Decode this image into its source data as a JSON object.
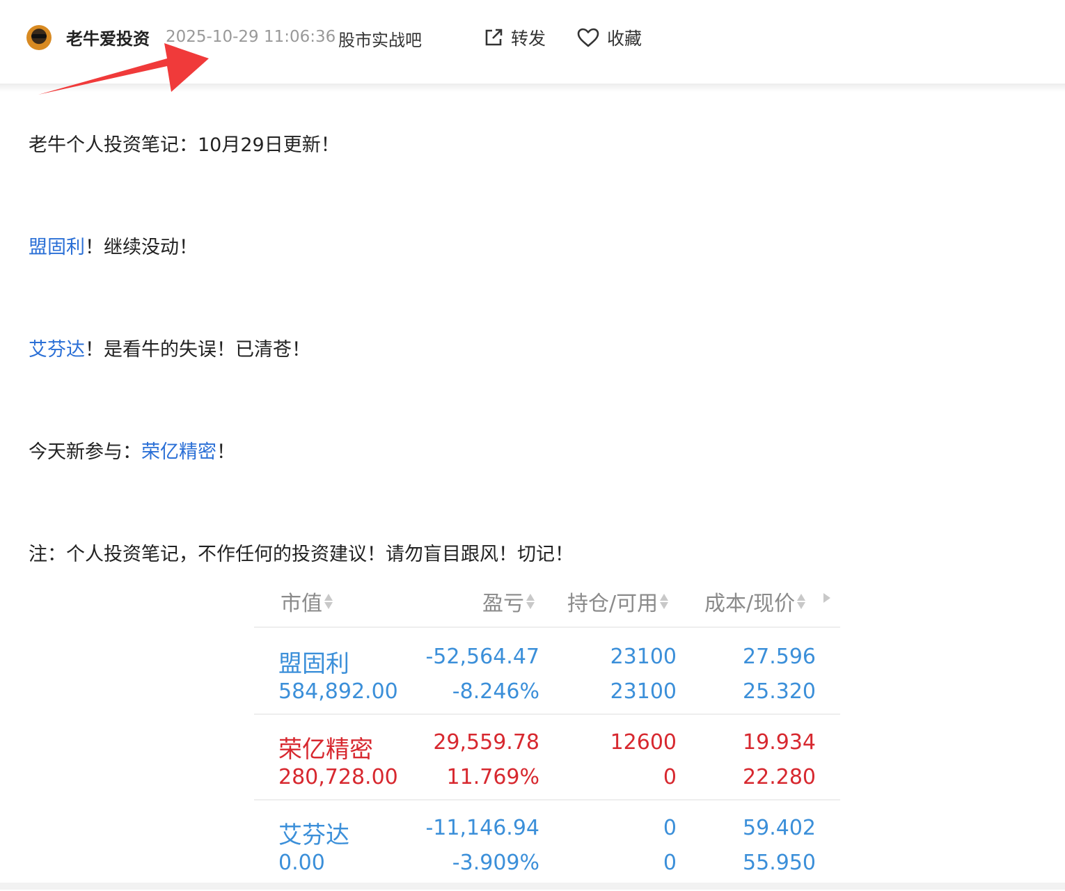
{
  "header": {
    "author": "老牛爱投资",
    "timestamp": "2025-10-29 11:06:36",
    "forum": "股市实战吧",
    "share_label": "转发",
    "favorite_label": "收藏",
    "share_icon": "share-icon",
    "favorite_icon": "heart-icon"
  },
  "post": {
    "title": "老牛个人投资笔记：10月29日更新！",
    "line1_link": "盟固利",
    "line1_text": "！继续没动！",
    "line2_link": "艾芬达",
    "line2_text": "！是看牛的失误！已清苍！",
    "line3_prefix": "今天新参与：",
    "line3_link": "荣亿精密",
    "line3_suffix": "！",
    "note": "注：个人投资笔记，不作任何的投资建议！请勿盲目跟风！切记！"
  },
  "table": {
    "headers": [
      "市值",
      "盈亏",
      "持仓/可用",
      "成本/现价"
    ],
    "rows": [
      {
        "name": "盟固利",
        "market_value": "584,892.00",
        "pnl": "-52,564.47",
        "pnl_pct": "-8.246%",
        "position": "23100",
        "available": "23100",
        "cost": "27.596",
        "price": "25.320",
        "color": "#3b8fd9"
      },
      {
        "name": "荣亿精密",
        "market_value": "280,728.00",
        "pnl": "29,559.78",
        "pnl_pct": "11.769%",
        "position": "12600",
        "available": "0",
        "cost": "19.934",
        "price": "22.280",
        "color": "#d7282f"
      },
      {
        "name": "艾芬达",
        "market_value": "0.00",
        "pnl": "-11,146.94",
        "pnl_pct": "-3.909%",
        "position": "0",
        "available": "0",
        "cost": "59.402",
        "price": "55.950",
        "color": "#3b8fd9"
      }
    ]
  },
  "colors": {
    "link": "#2a6fd6",
    "loss": "#3b8fd9",
    "gain": "#d7282f",
    "annotation_arrow": "#f03a3a"
  }
}
